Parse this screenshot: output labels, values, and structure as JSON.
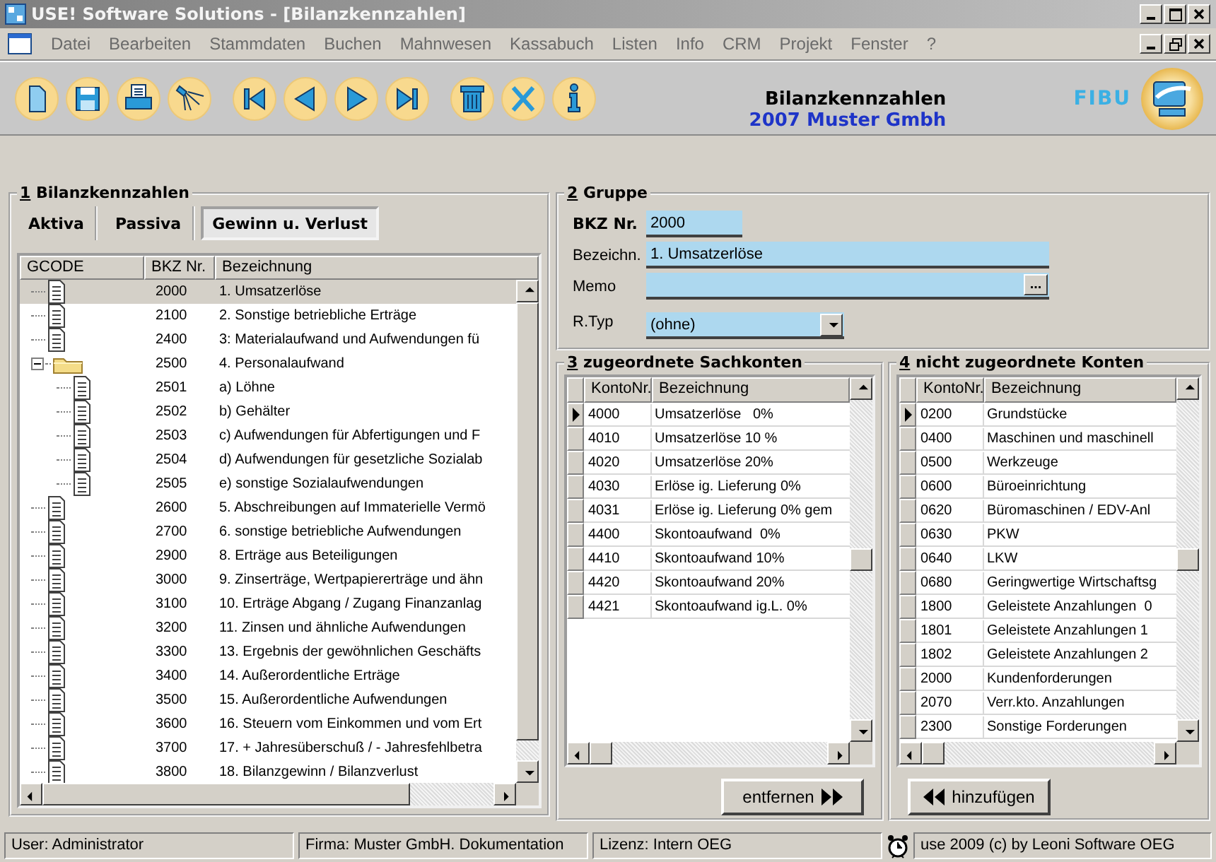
{
  "window": {
    "title": "USE! Software Solutions - [Bilanzkennzahlen]"
  },
  "menu": [
    "Datei",
    "Bearbeiten",
    "Stammdaten",
    "Buchen",
    "Mahnwesen",
    "Kassabuch",
    "Listen",
    "Info",
    "CRM",
    "Projekt",
    "Fenster",
    "?"
  ],
  "header": {
    "title": "Bilanzkennzahlen",
    "company": "2007 Muster Gmbh",
    "product": "FIBU"
  },
  "panel_1": {
    "number": "1",
    "title": "Bilanzkennzahlen",
    "tabs": [
      {
        "label": "Aktiva",
        "selected": false
      },
      {
        "label": "Passiva",
        "selected": false
      },
      {
        "label": "Gewinn u. Verlust",
        "selected": true
      }
    ],
    "columns": [
      "GCODE",
      "BKZ Nr.",
      "Bezeichnung"
    ],
    "rows": [
      {
        "nr": "2000",
        "label": "1. Umsatzerlöse",
        "selected": true
      },
      {
        "nr": "2100",
        "label": "2. Sonstige betriebliche Erträge",
        "selected": false
      },
      {
        "nr": "2400",
        "label": "3: Materialaufwand und Aufwendungen fü",
        "selected": false
      },
      {
        "nr": "2500",
        "label": "4. Personalaufwand",
        "selected": false,
        "expanded": true,
        "children": [
          {
            "nr": "2501",
            "label": "a) Löhne",
            "selected": false
          },
          {
            "nr": "2502",
            "label": "b) Gehälter",
            "selected": false
          },
          {
            "nr": "2503",
            "label": "c) Aufwendungen für Abfertigungen und F",
            "selected": false
          },
          {
            "nr": "2504",
            "label": "d) Aufwendungen für gesetzliche Sozialab",
            "selected": false
          },
          {
            "nr": "2505",
            "label": "e) sonstige Sozialaufwendungen",
            "selected": false
          }
        ]
      },
      {
        "nr": "2600",
        "label": "5. Abschreibungen auf Immaterielle Vermö",
        "selected": false
      },
      {
        "nr": "2700",
        "label": "6. sonstige betriebliche Aufwendungen",
        "selected": false
      },
      {
        "nr": "2900",
        "label": "8. Erträge aus Beteiligungen",
        "selected": false
      },
      {
        "nr": "3000",
        "label": "9. Zinserträge, Wertpapiererträge und ähn",
        "selected": false
      },
      {
        "nr": "3100",
        "label": "10. Erträge Abgang / Zugang Finanzanlag",
        "selected": false
      },
      {
        "nr": "3200",
        "label": "11. Zinsen und ähnliche Aufwendungen",
        "selected": false
      },
      {
        "nr": "3300",
        "label": "13. Ergebnis der gewöhnlichen Geschäfts",
        "selected": false
      },
      {
        "nr": "3400",
        "label": "14. Außerordentliche Erträge",
        "selected": false
      },
      {
        "nr": "3500",
        "label": "15. Außerordentliche Aufwendungen",
        "selected": false
      },
      {
        "nr": "3600",
        "label": "16. Steuern vom Einkommen und vom Ert",
        "selected": false
      },
      {
        "nr": "3700",
        "label": "17. + Jahresüberschuß / - Jahresfehlbetra",
        "selected": false
      },
      {
        "nr": "3800",
        "label": "18. Bilanzgewinn / Bilanzverlust",
        "selected": false
      }
    ]
  },
  "panel_2": {
    "number": "2",
    "title": "Gruppe",
    "fields": [
      {
        "kind": "short",
        "label": "BKZ Nr.",
        "bold": true,
        "value": "2000"
      },
      {
        "kind": "text",
        "label": "Bezeichn.",
        "bold": false,
        "value": "1. Umsatzerlöse"
      },
      {
        "kind": "memo",
        "label": "Memo",
        "bold": false,
        "button": "..."
      },
      {
        "kind": "select",
        "label": "R.Typ",
        "bold": false,
        "value": "(ohne)"
      }
    ]
  },
  "panel_3": {
    "number": "3",
    "title": "zugeordnete Sachkonten",
    "columns": [
      "KontoNr.",
      "Bezeichnung"
    ],
    "rows": [
      {
        "nr": "4000",
        "label": "Umsatzerlöse   0%",
        "selected": true
      },
      {
        "nr": "4010",
        "label": "Umsatzerlöse 10 %",
        "selected": false
      },
      {
        "nr": "4020",
        "label": "Umsatzerlöse 20%",
        "selected": false
      },
      {
        "nr": "4030",
        "label": "Erlöse ig. Lieferung 0%",
        "selected": false
      },
      {
        "nr": "4031",
        "label": "Erlöse ig. Lieferung 0% gem",
        "selected": false
      },
      {
        "nr": "4400",
        "label": "Skontoaufwand  0%",
        "selected": false
      },
      {
        "nr": "4410",
        "label": "Skontoaufwand 10%",
        "selected": false
      },
      {
        "nr": "4420",
        "label": "Skontoaufwand 20%",
        "selected": false
      },
      {
        "nr": "4421",
        "label": "Skontoaufwand ig.L. 0%",
        "selected": false
      }
    ],
    "button": "entfernen"
  },
  "panel_4": {
    "number": "4",
    "title": "nicht zugeordnete Konten",
    "columns": [
      "KontoNr.",
      "Bezeichnung"
    ],
    "rows": [
      {
        "nr": "0200",
        "label": "Grundstücke",
        "selected": true
      },
      {
        "nr": "0400",
        "label": "Maschinen und maschinell",
        "selected": false
      },
      {
        "nr": "0500",
        "label": "Werkzeuge",
        "selected": false
      },
      {
        "nr": "0600",
        "label": "Büroeinrichtung",
        "selected": false
      },
      {
        "nr": "0620",
        "label": "Büromaschinen / EDV-Anl",
        "selected": false
      },
      {
        "nr": "0630",
        "label": "PKW",
        "selected": false
      },
      {
        "nr": "0640",
        "label": "LKW",
        "selected": false
      },
      {
        "nr": "0680",
        "label": "Geringwertige Wirtschaftsg",
        "selected": false
      },
      {
        "nr": "1800",
        "label": "Geleistete Anzahlungen  0",
        "selected": false
      },
      {
        "nr": "1801",
        "label": "Geleistete Anzahlungen 1",
        "selected": false
      },
      {
        "nr": "1802",
        "label": "Geleistete Anzahlungen 2",
        "selected": false
      },
      {
        "nr": "2000",
        "label": "Kundenforderungen",
        "selected": false
      },
      {
        "nr": "2070",
        "label": "Verr.kto. Anzahlungen",
        "selected": false
      },
      {
        "nr": "2300",
        "label": "Sonstige Forderungen",
        "selected": false
      }
    ],
    "button": "hinzufügen"
  },
  "status_bar": [
    "User: Administrator",
    "Firma: Muster GmbH. Dokumentation",
    "Lizenz: Intern OEG",
    "use 2009 (c) by Leoni Software OEG"
  ]
}
